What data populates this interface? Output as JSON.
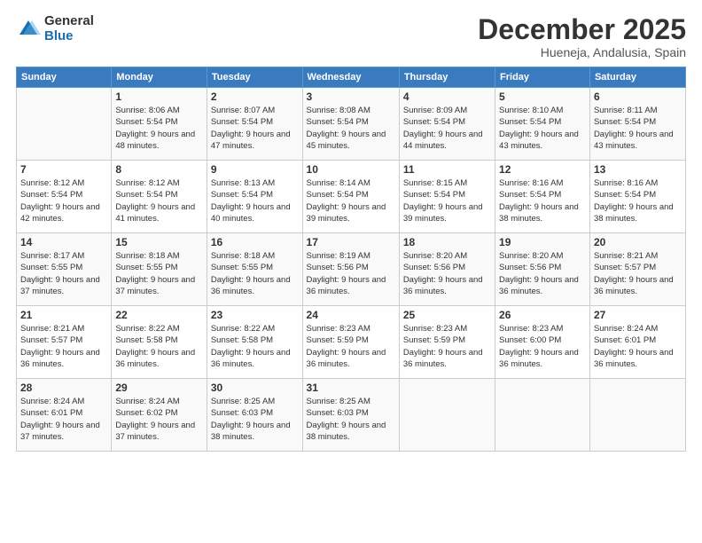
{
  "logo": {
    "general": "General",
    "blue": "Blue"
  },
  "title": "December 2025",
  "subtitle": "Hueneja, Andalusia, Spain",
  "header": {
    "days": [
      "Sunday",
      "Monday",
      "Tuesday",
      "Wednesday",
      "Thursday",
      "Friday",
      "Saturday"
    ]
  },
  "weeks": [
    [
      {
        "num": "",
        "sunrise": "",
        "sunset": "",
        "daylight": ""
      },
      {
        "num": "1",
        "sunrise": "Sunrise: 8:06 AM",
        "sunset": "Sunset: 5:54 PM",
        "daylight": "Daylight: 9 hours and 48 minutes."
      },
      {
        "num": "2",
        "sunrise": "Sunrise: 8:07 AM",
        "sunset": "Sunset: 5:54 PM",
        "daylight": "Daylight: 9 hours and 47 minutes."
      },
      {
        "num": "3",
        "sunrise": "Sunrise: 8:08 AM",
        "sunset": "Sunset: 5:54 PM",
        "daylight": "Daylight: 9 hours and 45 minutes."
      },
      {
        "num": "4",
        "sunrise": "Sunrise: 8:09 AM",
        "sunset": "Sunset: 5:54 PM",
        "daylight": "Daylight: 9 hours and 44 minutes."
      },
      {
        "num": "5",
        "sunrise": "Sunrise: 8:10 AM",
        "sunset": "Sunset: 5:54 PM",
        "daylight": "Daylight: 9 hours and 43 minutes."
      },
      {
        "num": "6",
        "sunrise": "Sunrise: 8:11 AM",
        "sunset": "Sunset: 5:54 PM",
        "daylight": "Daylight: 9 hours and 43 minutes."
      }
    ],
    [
      {
        "num": "7",
        "sunrise": "Sunrise: 8:12 AM",
        "sunset": "Sunset: 5:54 PM",
        "daylight": "Daylight: 9 hours and 42 minutes."
      },
      {
        "num": "8",
        "sunrise": "Sunrise: 8:12 AM",
        "sunset": "Sunset: 5:54 PM",
        "daylight": "Daylight: 9 hours and 41 minutes."
      },
      {
        "num": "9",
        "sunrise": "Sunrise: 8:13 AM",
        "sunset": "Sunset: 5:54 PM",
        "daylight": "Daylight: 9 hours and 40 minutes."
      },
      {
        "num": "10",
        "sunrise": "Sunrise: 8:14 AM",
        "sunset": "Sunset: 5:54 PM",
        "daylight": "Daylight: 9 hours and 39 minutes."
      },
      {
        "num": "11",
        "sunrise": "Sunrise: 8:15 AM",
        "sunset": "Sunset: 5:54 PM",
        "daylight": "Daylight: 9 hours and 39 minutes."
      },
      {
        "num": "12",
        "sunrise": "Sunrise: 8:16 AM",
        "sunset": "Sunset: 5:54 PM",
        "daylight": "Daylight: 9 hours and 38 minutes."
      },
      {
        "num": "13",
        "sunrise": "Sunrise: 8:16 AM",
        "sunset": "Sunset: 5:54 PM",
        "daylight": "Daylight: 9 hours and 38 minutes."
      }
    ],
    [
      {
        "num": "14",
        "sunrise": "Sunrise: 8:17 AM",
        "sunset": "Sunset: 5:55 PM",
        "daylight": "Daylight: 9 hours and 37 minutes."
      },
      {
        "num": "15",
        "sunrise": "Sunrise: 8:18 AM",
        "sunset": "Sunset: 5:55 PM",
        "daylight": "Daylight: 9 hours and 37 minutes."
      },
      {
        "num": "16",
        "sunrise": "Sunrise: 8:18 AM",
        "sunset": "Sunset: 5:55 PM",
        "daylight": "Daylight: 9 hours and 36 minutes."
      },
      {
        "num": "17",
        "sunrise": "Sunrise: 8:19 AM",
        "sunset": "Sunset: 5:56 PM",
        "daylight": "Daylight: 9 hours and 36 minutes."
      },
      {
        "num": "18",
        "sunrise": "Sunrise: 8:20 AM",
        "sunset": "Sunset: 5:56 PM",
        "daylight": "Daylight: 9 hours and 36 minutes."
      },
      {
        "num": "19",
        "sunrise": "Sunrise: 8:20 AM",
        "sunset": "Sunset: 5:56 PM",
        "daylight": "Daylight: 9 hours and 36 minutes."
      },
      {
        "num": "20",
        "sunrise": "Sunrise: 8:21 AM",
        "sunset": "Sunset: 5:57 PM",
        "daylight": "Daylight: 9 hours and 36 minutes."
      }
    ],
    [
      {
        "num": "21",
        "sunrise": "Sunrise: 8:21 AM",
        "sunset": "Sunset: 5:57 PM",
        "daylight": "Daylight: 9 hours and 36 minutes."
      },
      {
        "num": "22",
        "sunrise": "Sunrise: 8:22 AM",
        "sunset": "Sunset: 5:58 PM",
        "daylight": "Daylight: 9 hours and 36 minutes."
      },
      {
        "num": "23",
        "sunrise": "Sunrise: 8:22 AM",
        "sunset": "Sunset: 5:58 PM",
        "daylight": "Daylight: 9 hours and 36 minutes."
      },
      {
        "num": "24",
        "sunrise": "Sunrise: 8:23 AM",
        "sunset": "Sunset: 5:59 PM",
        "daylight": "Daylight: 9 hours and 36 minutes."
      },
      {
        "num": "25",
        "sunrise": "Sunrise: 8:23 AM",
        "sunset": "Sunset: 5:59 PM",
        "daylight": "Daylight: 9 hours and 36 minutes."
      },
      {
        "num": "26",
        "sunrise": "Sunrise: 8:23 AM",
        "sunset": "Sunset: 6:00 PM",
        "daylight": "Daylight: 9 hours and 36 minutes."
      },
      {
        "num": "27",
        "sunrise": "Sunrise: 8:24 AM",
        "sunset": "Sunset: 6:01 PM",
        "daylight": "Daylight: 9 hours and 36 minutes."
      }
    ],
    [
      {
        "num": "28",
        "sunrise": "Sunrise: 8:24 AM",
        "sunset": "Sunset: 6:01 PM",
        "daylight": "Daylight: 9 hours and 37 minutes."
      },
      {
        "num": "29",
        "sunrise": "Sunrise: 8:24 AM",
        "sunset": "Sunset: 6:02 PM",
        "daylight": "Daylight: 9 hours and 37 minutes."
      },
      {
        "num": "30",
        "sunrise": "Sunrise: 8:25 AM",
        "sunset": "Sunset: 6:03 PM",
        "daylight": "Daylight: 9 hours and 38 minutes."
      },
      {
        "num": "31",
        "sunrise": "Sunrise: 8:25 AM",
        "sunset": "Sunset: 6:03 PM",
        "daylight": "Daylight: 9 hours and 38 minutes."
      },
      {
        "num": "",
        "sunrise": "",
        "sunset": "",
        "daylight": ""
      },
      {
        "num": "",
        "sunrise": "",
        "sunset": "",
        "daylight": ""
      },
      {
        "num": "",
        "sunrise": "",
        "sunset": "",
        "daylight": ""
      }
    ]
  ]
}
